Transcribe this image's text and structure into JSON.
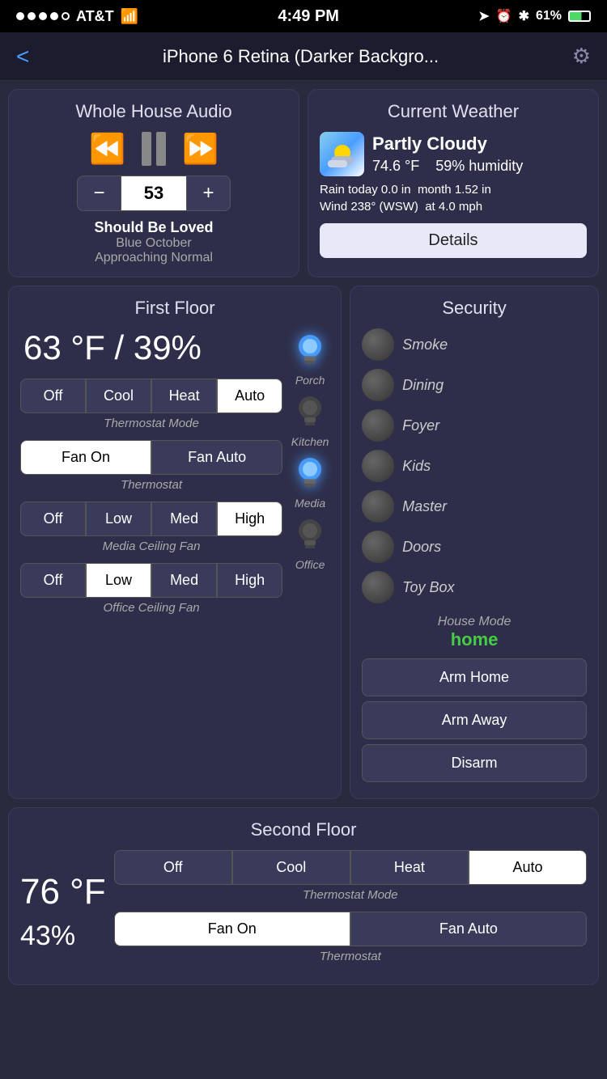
{
  "statusBar": {
    "carrier": "AT&T",
    "time": "4:49 PM",
    "battery": "61%"
  },
  "navBar": {
    "title": "iPhone 6 Retina (Darker Backgro...",
    "backLabel": "<",
    "gearLabel": "⚙"
  },
  "audio": {
    "cardTitle": "Whole House Audio",
    "volume": "53",
    "songTitle": "Should Be Loved",
    "artist": "Blue October",
    "album": "Approaching Normal",
    "minusLabel": "−",
    "plusLabel": "+"
  },
  "weather": {
    "cardTitle": "Current Weather",
    "condition": "Partly Cloudy",
    "temp": "74.6 °F",
    "humidity": "59% humidity",
    "rainTodayLabel": "Rain today",
    "rainTodayValue": "0.0 in",
    "monthLabel": "month",
    "monthValue": "1.52 in",
    "windLabel": "Wind",
    "windValue": "238° (WSW)",
    "atLabel": "at",
    "windSpeed": "4.0 mph",
    "detailsBtn": "Details"
  },
  "firstFloor": {
    "cardTitle": "First Floor",
    "tempHumidity": "63 °F / 39%",
    "thermostatModes": [
      "Off",
      "Cool",
      "Heat",
      "Auto"
    ],
    "thermostatActiveMode": "Auto",
    "thermostatLabel": "Thermostat Mode",
    "fanModes": [
      "Fan On",
      "Fan Auto"
    ],
    "fanActiveMode": "Fan On",
    "fanLabel": "Thermostat",
    "fanSpeeds": [
      "Off",
      "Low",
      "Med",
      "High"
    ],
    "mediaFanActive": "High",
    "mediaFanLabel": "Media Ceiling Fan",
    "officeFanActive": "Low",
    "officeFanLabel": "Office Ceiling Fan",
    "lights": [
      {
        "label": "Porch",
        "on": true
      },
      {
        "label": "Kitchen",
        "on": false
      },
      {
        "label": "Media",
        "on": true
      },
      {
        "label": "Office",
        "on": false
      }
    ]
  },
  "security": {
    "cardTitle": "Security",
    "items": [
      "Smoke",
      "Dining",
      "Foyer",
      "Kids",
      "Master",
      "Doors",
      "Toy Box"
    ],
    "houseModeLabel": "House Mode",
    "houseModeValue": "home",
    "armHome": "Arm Home",
    "armAway": "Arm Away",
    "disarm": "Disarm"
  },
  "secondFloor": {
    "cardTitle": "Second Floor",
    "temp": "76 °F",
    "humidity": "43%",
    "thermostatModes": [
      "Off",
      "Cool",
      "Heat",
      "Auto"
    ],
    "thermostatActiveMode": "Auto",
    "thermostatLabel": "Thermostat Mode",
    "fanModes": [
      "Fan On",
      "Fan Auto"
    ],
    "fanActiveMode": "Fan On",
    "fanLabel": "Thermostat"
  }
}
